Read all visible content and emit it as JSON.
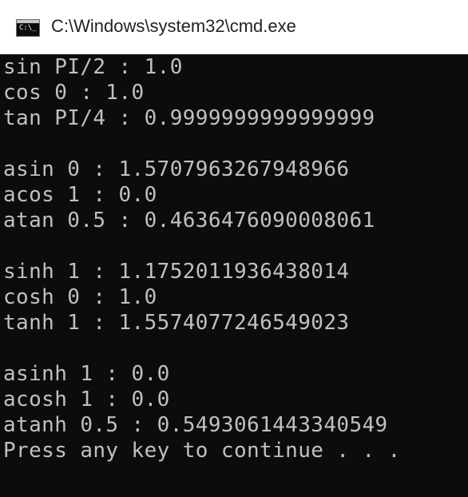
{
  "window": {
    "title": "C:\\Windows\\system32\\cmd.exe",
    "icon": "cmd-console-icon",
    "icon_prompt": "C:\\_"
  },
  "console": {
    "text_color": "#c0c0c0",
    "background_color": "#0c0c0c",
    "lines": [
      "sin PI/2 : 1.0",
      "cos 0 : 1.0",
      "tan PI/4 : 0.9999999999999999",
      "",
      "asin 0 : 1.5707963267948966",
      "acos 1 : 0.0",
      "atan 0.5 : 0.4636476090008061",
      "",
      "sinh 1 : 1.1752011936438014",
      "cosh 0 : 1.0",
      "tanh 1 : 1.5574077246549023",
      "",
      "asinh 1 : 0.0",
      "acosh 1 : 0.0",
      "atanh 0.5 : 0.5493061443340549",
      "Press any key to continue . . ."
    ]
  }
}
